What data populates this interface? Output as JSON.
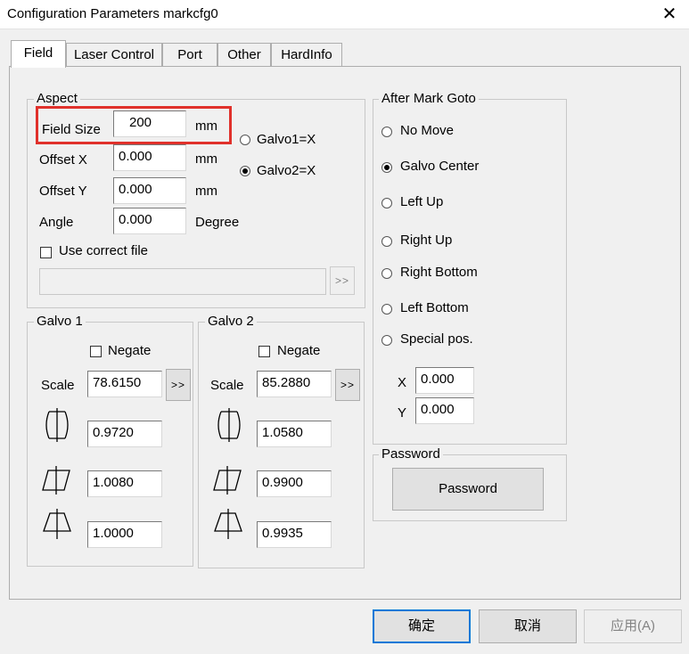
{
  "window": {
    "title": "Configuration Parameters markcfg0"
  },
  "tabs": [
    "Field",
    "Laser Control",
    "Port",
    "Other",
    "HardInfo"
  ],
  "aspect": {
    "group_label": "Aspect",
    "field_size_label": "Field Size",
    "field_size_value": "200",
    "offset_x_label": "Offset X",
    "offset_x_value": "0.000",
    "offset_y_label": "Offset Y",
    "offset_y_value": "0.000",
    "angle_label": "Angle",
    "angle_value": "0.000",
    "unit_mm": "mm",
    "unit_degree": "Degree",
    "galvo1_x": "Galvo1=X",
    "galvo2_x": "Galvo2=X",
    "use_correct_file": "Use correct file",
    "correct_file_path": "",
    "browse": ">>"
  },
  "galvo1": {
    "group_label": "Galvo 1",
    "negate": "Negate",
    "scale_label": "Scale",
    "scale": "78.6150",
    "barrel": "0.9720",
    "parallelogram": "1.0080",
    "trapezoid": "1.0000",
    "more": ">>"
  },
  "galvo2": {
    "group_label": "Galvo 2",
    "negate": "Negate",
    "scale_label": "Scale",
    "scale": "85.2880",
    "barrel": "1.0580",
    "parallelogram": "0.9900",
    "trapezoid": "0.9935",
    "more": ">>"
  },
  "after_mark": {
    "group_label": "After Mark Goto",
    "options": [
      "No Move",
      "Galvo Center",
      "Left Up",
      "Right Up",
      "Right Bottom",
      "Left Bottom",
      "Special pos."
    ],
    "selected": "Galvo Center",
    "x_label": "X",
    "x_value": "0.000",
    "y_label": "Y",
    "y_value": "0.000"
  },
  "password": {
    "group_label": "Password",
    "button": "Password"
  },
  "footer": {
    "ok": "确定",
    "cancel": "取消",
    "apply": "应用(A)"
  }
}
